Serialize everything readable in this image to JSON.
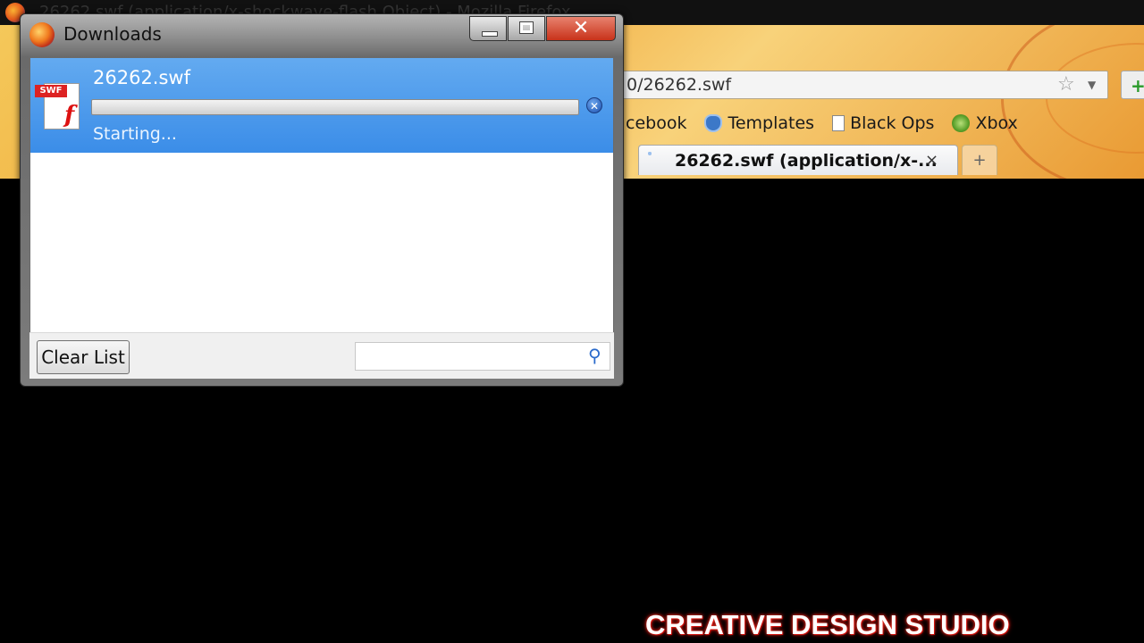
{
  "background_window": {
    "title": "26262.swf (application/x-shockwave-flash Object) - Mozilla Firefox",
    "url": "0/26262.swf",
    "bookmarks": [
      {
        "label": "cebook",
        "icon": "none"
      },
      {
        "label": "Templates",
        "icon": "mask-icon"
      },
      {
        "label": "Black Ops",
        "icon": "page-icon"
      },
      {
        "label": "Xbox",
        "icon": "xbox-icon"
      }
    ],
    "tab": {
      "title": "26262.swf (application/x-...",
      "close": "×"
    },
    "new_tab": "+"
  },
  "dialog": {
    "title": "Downloads",
    "controls": {
      "close": "✕"
    },
    "download": {
      "file_name": "26262.swf",
      "file_type_label": "SWF",
      "status": "Starting...",
      "progress": 0,
      "cancel": "✕"
    },
    "footer": {
      "clear_label": "Clear List",
      "search_placeholder": ""
    }
  },
  "watermark": "CREATIVE DESIGN STUDIO",
  "colors": {
    "selection_blue": "#3b8de8",
    "close_red": "#c8321a",
    "watermark_glow": "#e32222"
  }
}
